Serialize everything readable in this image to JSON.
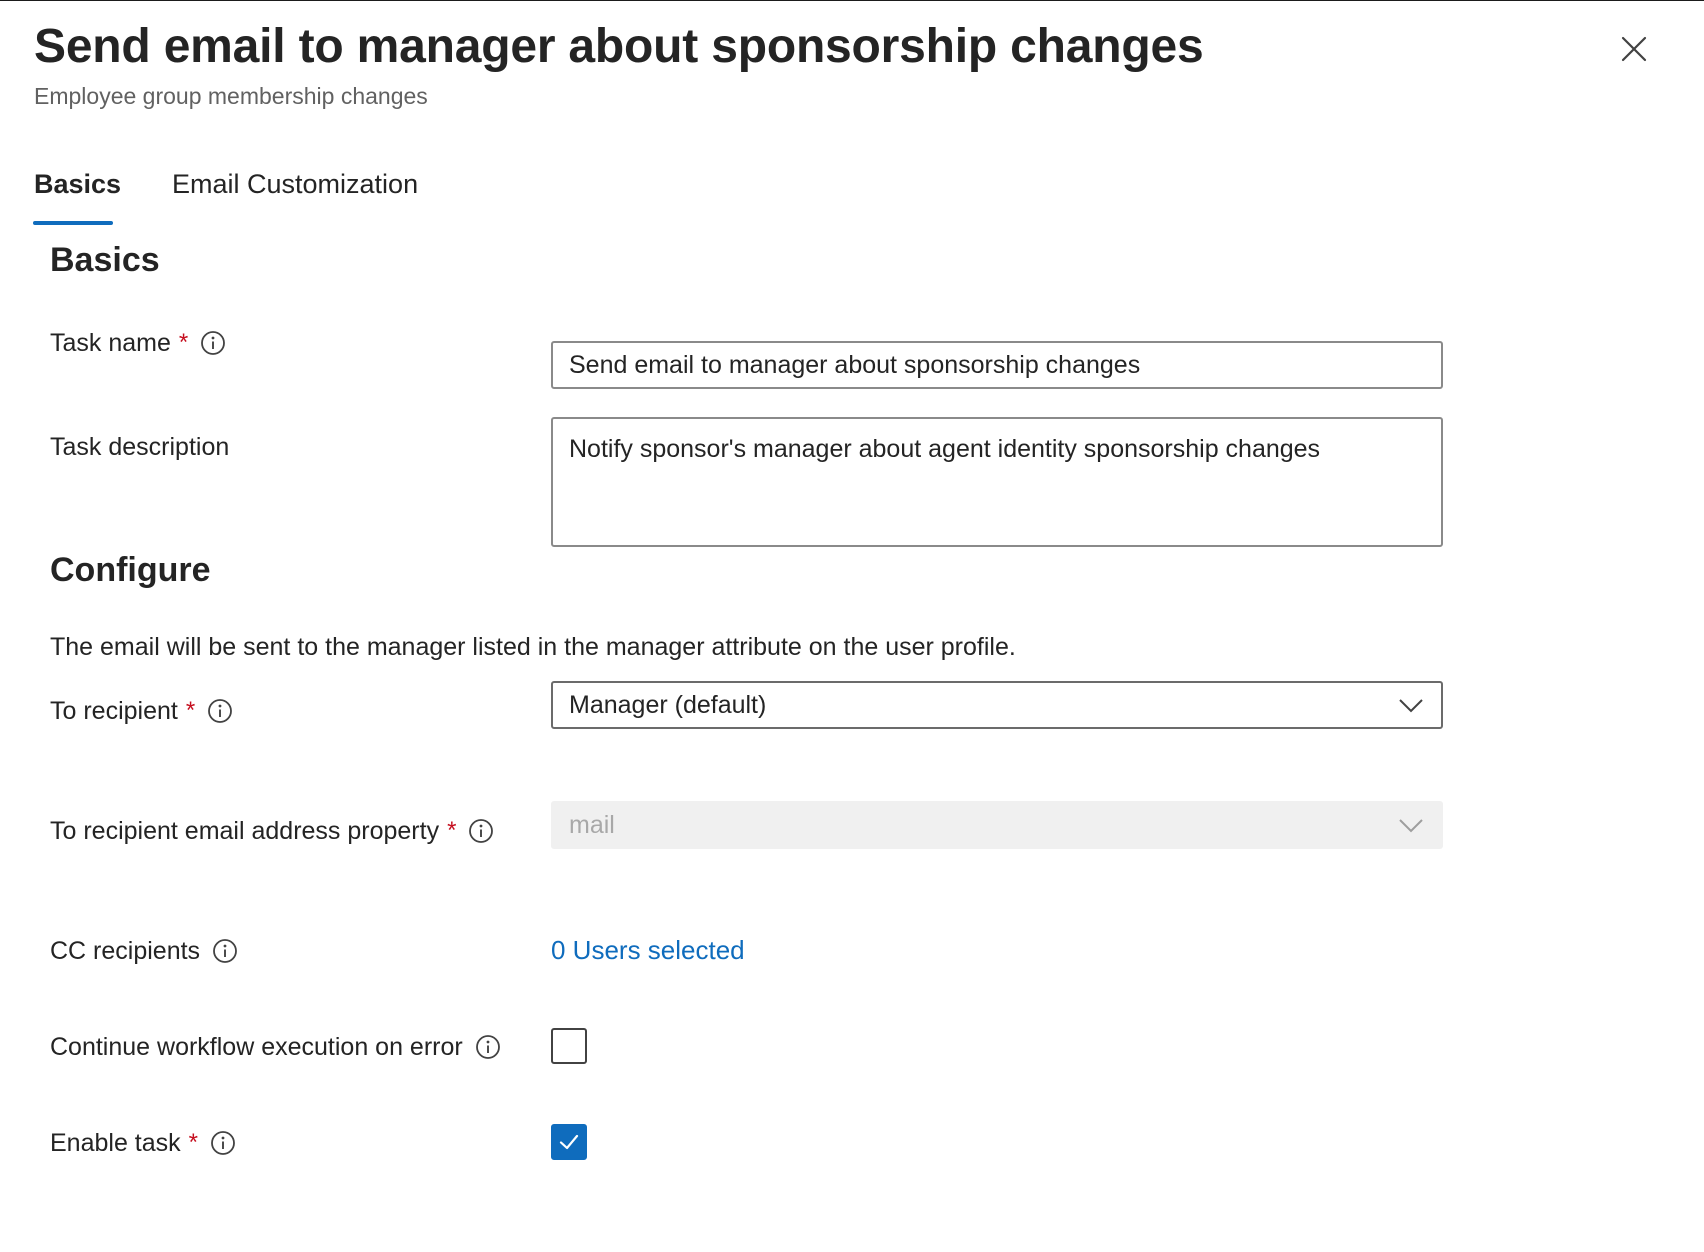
{
  "panel": {
    "title": "Send email to manager about sponsorship changes",
    "subtitle": "Employee group membership changes"
  },
  "tabs": [
    {
      "label": "Basics",
      "active": true
    },
    {
      "label": "Email Customization",
      "active": false
    }
  ],
  "basics": {
    "section_title": "Basics",
    "task_name": {
      "label": "Task name",
      "required_mark": "*",
      "value": "Send email to manager about sponsorship changes"
    },
    "task_description": {
      "label": "Task description",
      "value": "Notify sponsor's manager about agent identity sponsorship changes"
    }
  },
  "configure": {
    "section_title": "Configure",
    "description": "The email will be sent to the manager listed in the manager attribute on the user profile.",
    "to_recipient": {
      "label": "To recipient",
      "required_mark": "*",
      "value": "Manager (default)"
    },
    "email_property": {
      "label": "To recipient email address property",
      "required_mark": "*",
      "value": "mail"
    },
    "cc_recipients": {
      "label": "CC recipients",
      "link_text": "0 Users selected"
    },
    "continue_on_error": {
      "label": "Continue workflow execution on error",
      "checked": false
    },
    "enable_task": {
      "label": "Enable task",
      "required_mark": "*",
      "checked": true
    }
  },
  "colors": {
    "accent": "#0f6cbd",
    "required": "#c50f1f"
  }
}
